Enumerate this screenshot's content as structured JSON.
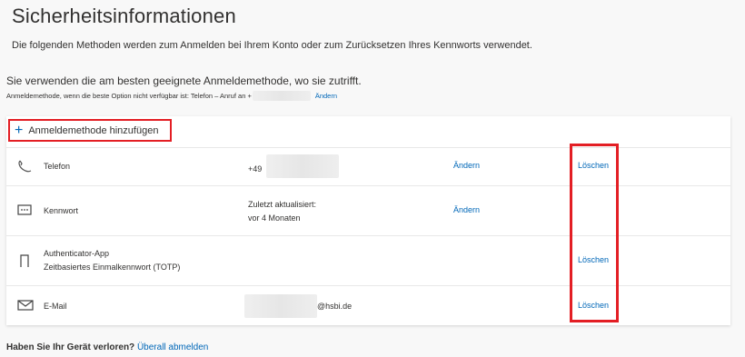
{
  "page": {
    "title": "Sicherheitsinformationen",
    "subtitle": "Die folgenden Methoden werden zum Anmelden bei Ihrem Konto oder zum Zurücksetzen Ihres Kennworts verwendet."
  },
  "default_method": {
    "headline": "Sie verwenden die am besten geeignete Anmeldemethode, wo sie zutrifft.",
    "fallback_text": "Anmeldemethode, wenn die beste Option nicht verfügbar ist: Telefon – Anruf an +",
    "change_label": "Ändern"
  },
  "add_method": {
    "label": "Anmeldemethode hinzufügen",
    "icon": "plus-icon"
  },
  "methods": [
    {
      "name": "Telefon",
      "icon": "phone-icon",
      "detail": "+49",
      "change": "Ändern",
      "delete": "Löschen"
    },
    {
      "name": "Kennwort",
      "icon": "password-icon",
      "detail_line1": "Zuletzt aktualisiert:",
      "detail_line2": "vor 4 Monaten",
      "change": "Ändern"
    },
    {
      "name_line1": "Authenticator-App",
      "name_line2": "Zeitbasiertes Einmalkennwort (TOTP)",
      "icon": "authenticator-icon",
      "delete": "Löschen"
    },
    {
      "name": "E-Mail",
      "icon": "mail-icon",
      "detail": "@hsbi.de",
      "delete": "Löschen"
    }
  ],
  "footer": {
    "question": "Haben Sie Ihr Gerät verloren?",
    "link": "Überall abmelden"
  },
  "colors": {
    "accent": "#0067b8",
    "highlight": "#e31e24"
  }
}
